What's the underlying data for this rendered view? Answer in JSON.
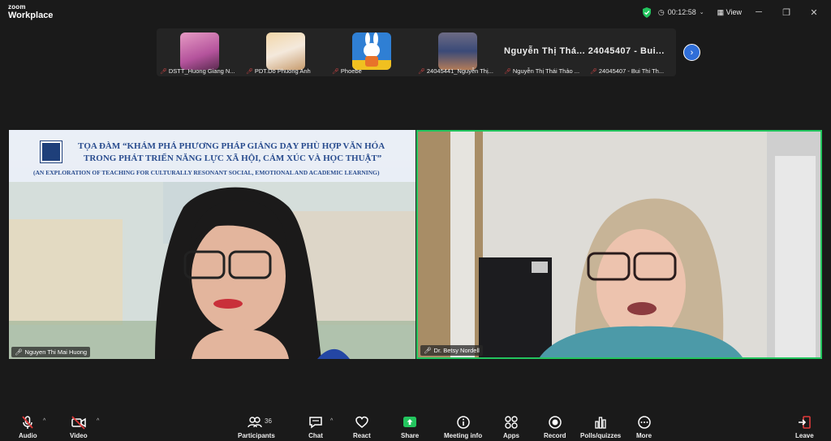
{
  "app": {
    "brand_top": "zoom",
    "brand_bottom": "Workplace"
  },
  "titlebar": {
    "timer": "00:12:58",
    "view_label": "View"
  },
  "participants_strip": [
    {
      "name": "DSTT_Huong Giang N..."
    },
    {
      "name": "PDT.Do Phuong Anh"
    },
    {
      "name": "Phoebe"
    },
    {
      "name": "24045441_Nguyễn Thị..."
    },
    {
      "name": "Nguyễn Thị Thái Thảo ..."
    },
    {
      "name": "24045407 - Bui Thi Th..."
    }
  ],
  "strip_bignames": "Nguyễn Thị Thá...   24045407 - Bui...",
  "main": {
    "left": {
      "name": "Nguyen Thi Mai Huong",
      "title_line1": "TỌA ĐÀM “KHÁM PHÁ PHƯƠNG PHÁP GIẢNG DẠY PHÙ HỢP VĂN HÓA",
      "title_line2": "TRONG PHÁT TRIỂN NĂNG LỰC XÃ HỘI, CẢM XÚC VÀ HỌC THUẬT”",
      "subtitle": "(AN EXPLORATION OF TEACHING FOR CULTURALLY RESONANT SOCIAL, EMOTIONAL AND ACADEMIC LEARNING)"
    },
    "right": {
      "name": "Dr. Betsy Nordell"
    }
  },
  "toolbar": {
    "audio": "Audio",
    "video": "Video",
    "participants": "Participants",
    "participants_count": "36",
    "chat": "Chat",
    "react": "React",
    "share": "Share",
    "meeting_info": "Meeting info",
    "apps": "Apps",
    "record": "Record",
    "polls": "Polls/quizzes",
    "more": "More",
    "leave": "Leave"
  },
  "colors": {
    "active_speaker": "#23c55e",
    "share_green": "#23c55e",
    "leave_red": "#e03a3a"
  }
}
